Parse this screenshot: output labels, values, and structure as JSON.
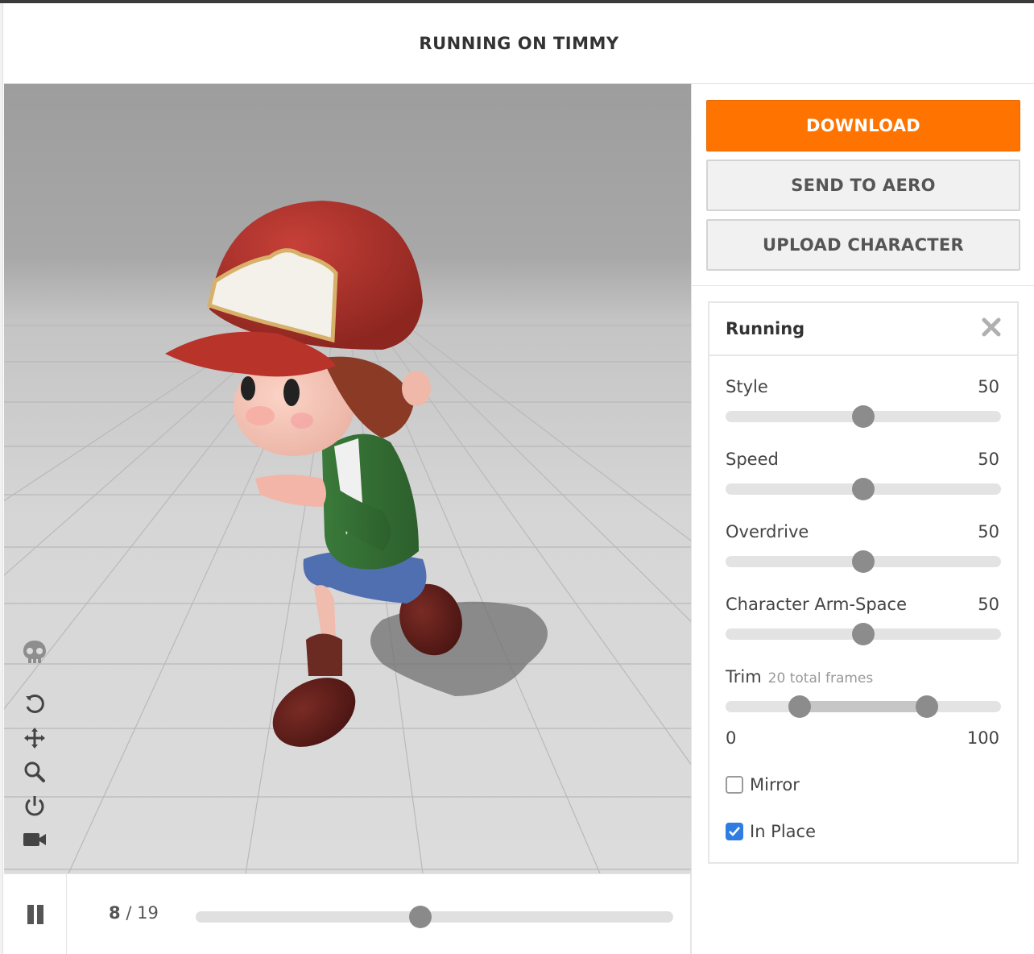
{
  "header": {
    "title": "RUNNING ON TIMMY"
  },
  "viewport": {
    "tools": [
      {
        "name": "skeleton-icon"
      },
      {
        "name": "reset-rotate-icon"
      },
      {
        "name": "pan-icon"
      },
      {
        "name": "zoom-icon"
      },
      {
        "name": "power-icon"
      },
      {
        "name": "camera-icon"
      }
    ]
  },
  "playback": {
    "current_frame": "8",
    "separator": "/",
    "total_frames": "19",
    "progress": 0.47
  },
  "sidebar": {
    "download_label": "DOWNLOAD",
    "send_label": "SEND TO AERO",
    "upload_label": "UPLOAD CHARACTER",
    "accent_color": "#ff7400"
  },
  "panel": {
    "title": "Running",
    "sliders": [
      {
        "label": "Style",
        "value": "50",
        "fraction": 0.5
      },
      {
        "label": "Speed",
        "value": "50",
        "fraction": 0.5
      },
      {
        "label": "Overdrive",
        "value": "50",
        "fraction": 0.5
      },
      {
        "label": "Character Arm-Space",
        "value": "50",
        "fraction": 0.5
      }
    ],
    "trim": {
      "label": "Trim",
      "sublabel": "20 total frames",
      "min_label": "0",
      "max_label": "100",
      "start_fraction": 0.27,
      "end_fraction": 0.73
    },
    "mirror": {
      "label": "Mirror",
      "checked": false
    },
    "in_place": {
      "label": "In Place",
      "checked": true,
      "check_color": "#2f7de1"
    }
  }
}
